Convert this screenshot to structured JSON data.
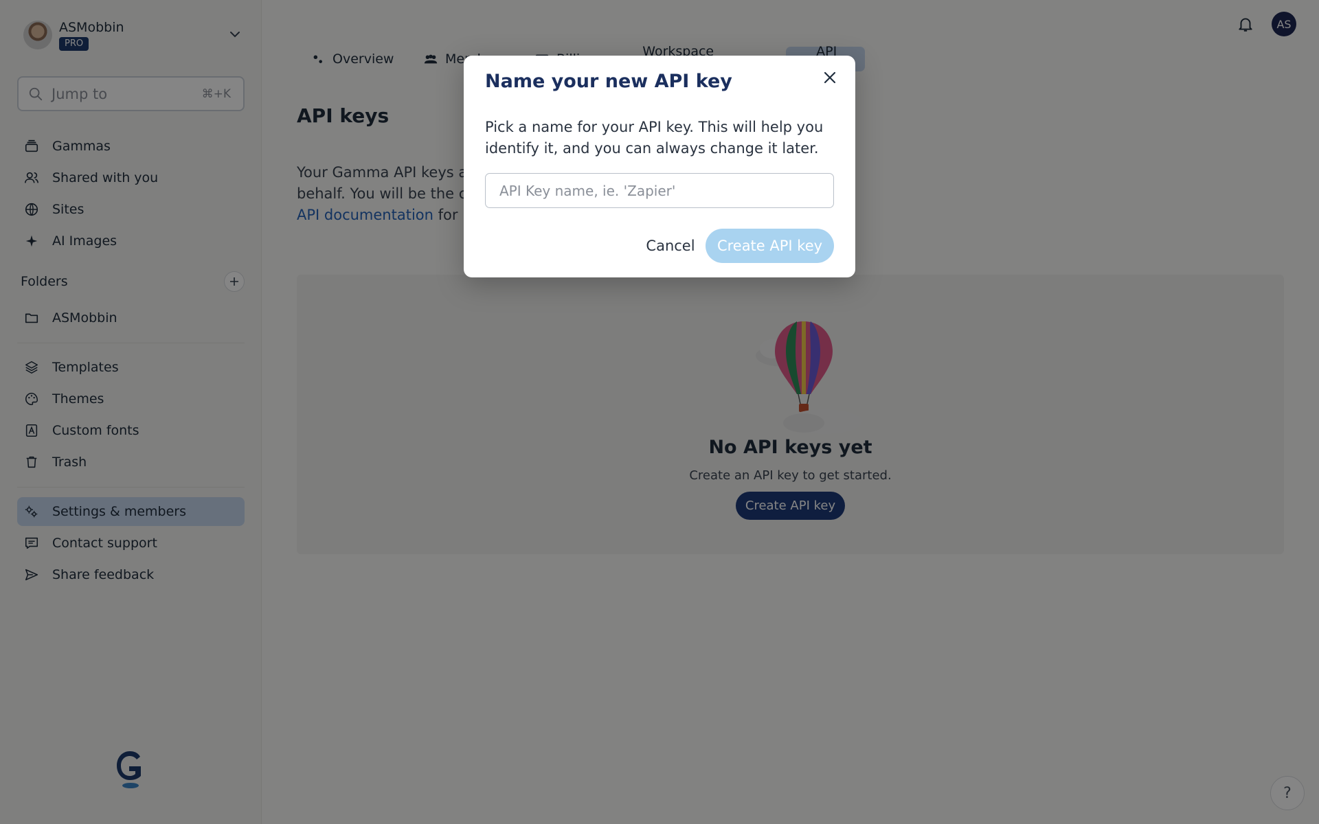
{
  "account": {
    "name": "ASMobbin",
    "plan_badge": "PRO"
  },
  "search": {
    "placeholder": "Jump to",
    "shortcut": "⌘+K"
  },
  "sidebar": {
    "items": [
      {
        "label": "Gammas",
        "icon": "stack-icon"
      },
      {
        "label": "Shared with you",
        "icon": "users-icon"
      },
      {
        "label": "Sites",
        "icon": "globe-icon"
      },
      {
        "label": "AI Images",
        "icon": "sparkle-icon"
      }
    ],
    "folders_label": "Folders",
    "folders": [
      {
        "label": "ASMobbin",
        "icon": "folder-icon"
      }
    ],
    "tools": [
      {
        "label": "Templates",
        "icon": "layers-icon"
      },
      {
        "label": "Themes",
        "icon": "palette-icon"
      },
      {
        "label": "Custom fonts",
        "icon": "font-icon"
      },
      {
        "label": "Trash",
        "icon": "trash-icon"
      }
    ],
    "footer": [
      {
        "label": "Settings & members",
        "icon": "gears-icon",
        "active": true
      },
      {
        "label": "Contact support",
        "icon": "chat-icon"
      },
      {
        "label": "Share feedback",
        "icon": "send-icon"
      }
    ]
  },
  "topbar": {
    "avatar_initials": "AS"
  },
  "tabs": [
    {
      "label": "Overview",
      "icon": "gears-icon"
    },
    {
      "label": "Members",
      "icon": "users-icon"
    },
    {
      "label": "Billing",
      "icon": "card-icon"
    },
    {
      "label": "Workspace defaults",
      "icon": "briefcase-icon"
    },
    {
      "label": "API keys",
      "icon": "key-icon",
      "active": true
    }
  ],
  "page": {
    "title": "API keys",
    "intro_prefix": "Your Gamma API keys are",
    "intro_line2": "behalf. You will be the crea",
    "doc_link": "API documentation",
    "intro_suffix": " for mo"
  },
  "empty_state": {
    "title": "No API keys yet",
    "subtitle": "Create an API key to get started.",
    "button": "Create API key"
  },
  "help": {
    "label": "?"
  },
  "modal": {
    "title": "Name your new API key",
    "description": "Pick a name for your API key. This will help you identify it, and you can always change it later.",
    "input_placeholder": "API Key name, ie. 'Zapier'",
    "input_value": "",
    "cancel_label": "Cancel",
    "create_label": "Create API key"
  },
  "colors": {
    "accent_dark": "#1d3a7a",
    "active_nav_bg": "#c6d6ee",
    "disabled_button": "#a9d3f0",
    "link": "#2563b8"
  }
}
